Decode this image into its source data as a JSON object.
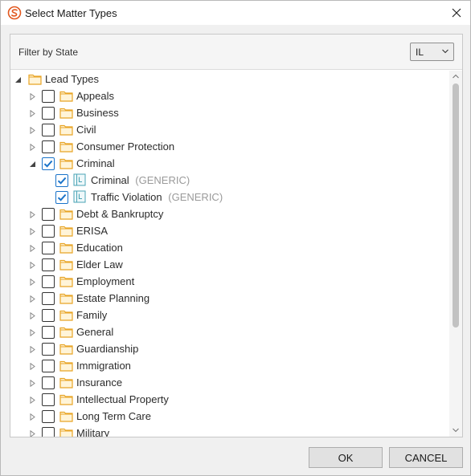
{
  "window": {
    "title": "Select Matter Types",
    "close_glyph": "✕",
    "app_icon": "app-logo-icon"
  },
  "filter": {
    "label": "Filter by State",
    "state_value": "IL"
  },
  "tree": {
    "root": {
      "label": "Lead Types",
      "expanded": true
    },
    "items": [
      {
        "label": "Appeals",
        "expanded": false,
        "checked": false
      },
      {
        "label": "Business",
        "expanded": false,
        "checked": false
      },
      {
        "label": "Civil",
        "expanded": false,
        "checked": false
      },
      {
        "label": "Consumer Protection",
        "expanded": false,
        "checked": false
      },
      {
        "label": "Criminal",
        "expanded": true,
        "checked": true,
        "children": [
          {
            "label": "Criminal",
            "tag": "(GENERIC)",
            "checked": true
          },
          {
            "label": "Traffic Violation",
            "tag": "(GENERIC)",
            "checked": true
          }
        ]
      },
      {
        "label": "Debt & Bankruptcy",
        "expanded": false,
        "checked": false
      },
      {
        "label": "ERISA",
        "expanded": false,
        "checked": false
      },
      {
        "label": "Education",
        "expanded": false,
        "checked": false
      },
      {
        "label": "Elder Law",
        "expanded": false,
        "checked": false
      },
      {
        "label": "Employment",
        "expanded": false,
        "checked": false
      },
      {
        "label": "Estate Planning",
        "expanded": false,
        "checked": false
      },
      {
        "label": "Family",
        "expanded": false,
        "checked": false
      },
      {
        "label": "General",
        "expanded": false,
        "checked": false
      },
      {
        "label": "Guardianship",
        "expanded": false,
        "checked": false
      },
      {
        "label": "Immigration",
        "expanded": false,
        "checked": false
      },
      {
        "label": "Insurance",
        "expanded": false,
        "checked": false
      },
      {
        "label": "Intellectual Property",
        "expanded": false,
        "checked": false
      },
      {
        "label": "Long Term Care",
        "expanded": false,
        "checked": false
      },
      {
        "label": "Military",
        "expanded": false,
        "checked": false
      }
    ]
  },
  "buttons": {
    "ok": "OK",
    "cancel": "CANCEL"
  },
  "colors": {
    "folder": "#e8a526",
    "checkmark": "#1a73c9",
    "leaf_icon": "#4aa3b5",
    "app_icon": "#e2571e"
  }
}
